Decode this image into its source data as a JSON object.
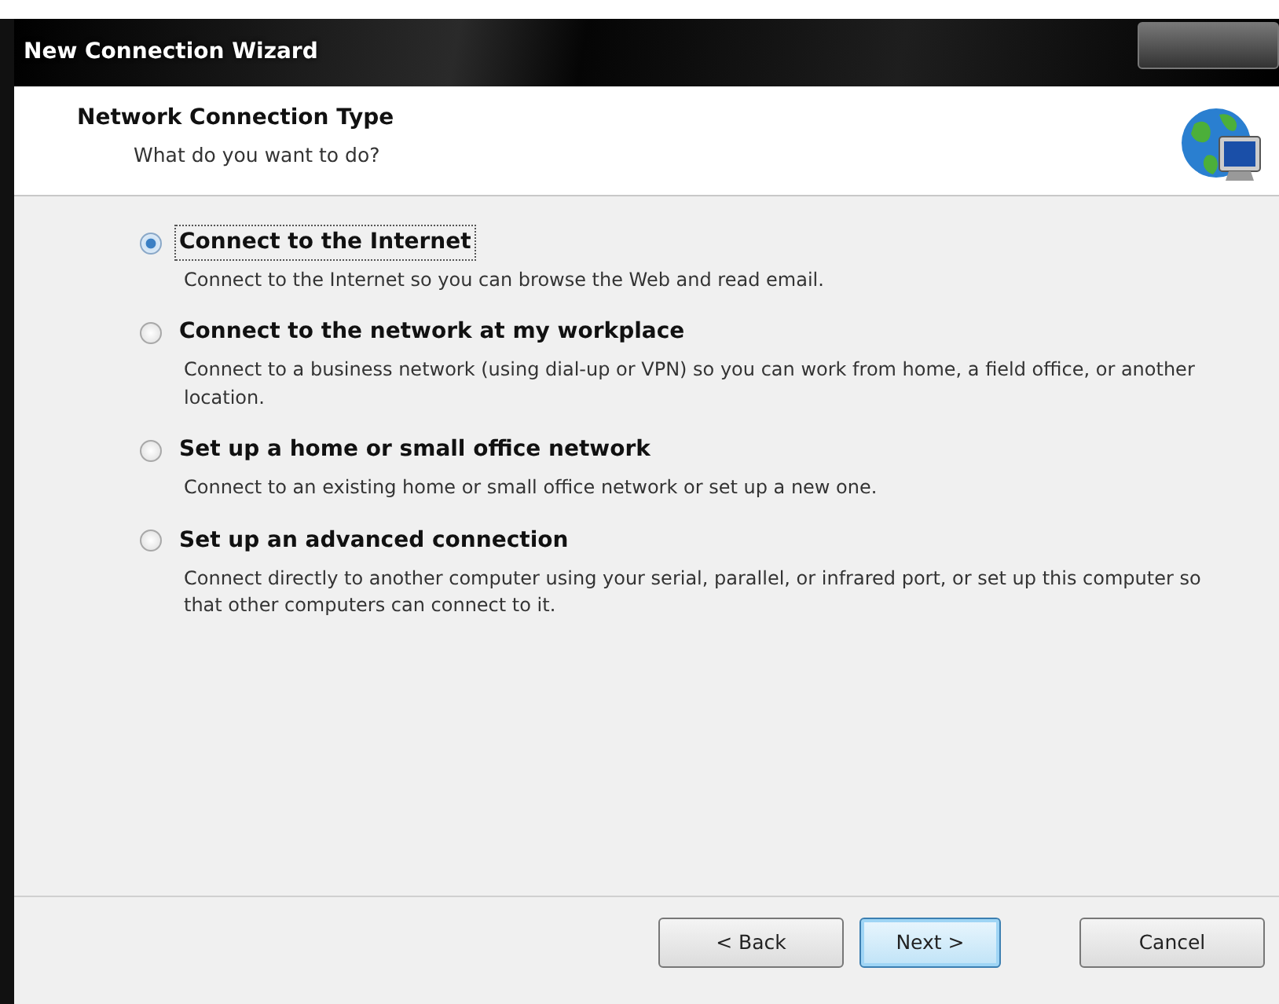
{
  "window": {
    "title": "New Connection Wizard"
  },
  "header": {
    "title": "Network Connection Type",
    "subtitle": "What do you want to do?"
  },
  "options": [
    {
      "label": "Connect to the Internet",
      "description": "Connect to the Internet so you can browse the Web and read email.",
      "selected": true
    },
    {
      "label": "Connect to the network at my workplace",
      "description": "Connect to a business network (using dial-up or VPN) so you can work from home, a field office, or another location.",
      "selected": false
    },
    {
      "label": "Set up a home or small office network",
      "description": "Connect to an existing home or small office network or set up a new one.",
      "selected": false
    },
    {
      "label": "Set up an advanced connection",
      "description": "Connect directly to another computer using your serial, parallel, or infrared port, or set up this computer so that other computers can connect to it.",
      "selected": false
    }
  ],
  "buttons": [
    {
      "label": "< Back",
      "default": false
    },
    {
      "label": "Next >",
      "default": true
    },
    {
      "label": "Cancel",
      "default": false
    }
  ]
}
